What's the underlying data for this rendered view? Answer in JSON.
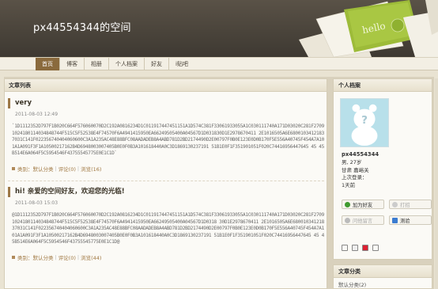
{
  "header": {
    "site_title": "px44554344的空间"
  },
  "nav": [
    {
      "label": "首页",
      "active": true
    },
    {
      "label": "博客",
      "active": false
    },
    {
      "label": "相册",
      "active": false
    },
    {
      "label": "个人档案",
      "active": false
    },
    {
      "label": "好友",
      "active": false
    },
    {
      "label": "i贴吧",
      "active": false
    }
  ],
  "main": {
    "heading": "文章列表",
    "posts": [
      {
        "title": "very",
        "date": "2011-08-03 12:49",
        "body": "`1D1112352D797F1B020C664F576060070D2C192A0816234D1C011917447451151A1D574C381F33061933055A1C030111740A171D03020C281F27091024180114034848744F515C5F52538E4F74570F6A4941415950EA66249505400A04567D1D031830D1E2978670411 2E1016505A6E68001034121837031C141F022356740404060600C3A1A235AC48E88BFC08AADADEB8A4ABD781D2BD2174490D2E00797F0B0E123E0D0B170F5E556A40745F454A7A101A1A091F3F1A10500217162B4D6948003007405B0E0F0B3A101618440A0C3D1869130237191 51B1E0F1F351901051F020C74416956447645 45 45B514E6A064F5C5954546F43755545775E0E1C1D`",
        "category": "类别：默认分类",
        "comments": "评论(0)",
        "views": "浏览(16)"
      },
      {
        "title": "hi! 亲爱的空间好友，欢迎您的光临!",
        "date": "2011-08-03 15:03",
        "body": "@1D1112352D797F1B020C664F576060070D2C192A0816234D1C011917447451151A1D574C381F33061933055A1C030111740A171D03020C281F27091024180114034848744F515C5F52538E4F74570F6A4941415950EA66249505400A04567D1D0318 30D1E2978670411 2E1016505A6E68001034121837031C141F022356740404060600C3A1A235AC48E88BFC08AADADEB8A4ABD781D2BD2174490D2E00797F0B0E123E0D0B170F5E556A40745F454A7A101A1A091F3F1A10500217162B4D6948003007405B0E0F0B3A101618440A0C3D1869130237191 51B1E0F1F351901051F020C74416956447645 45 45B514E6A064F5C5954546F43755545775E0E1C1D@",
        "category": "类别：默认分类",
        "comments": "评论(0)",
        "views": "浏览(44)"
      }
    ]
  },
  "sidebar": {
    "heading": "个人档案",
    "username": "px44554344",
    "lines": [
      "男, 27岁",
      "甘肃 嘉峪关",
      "上次登录：",
      "1天前"
    ],
    "actions": [
      {
        "label": "加为好友",
        "icon": "add-friend-icon",
        "enabled": true
      },
      {
        "label": "打招",
        "icon": "greet-icon",
        "enabled": false
      },
      {
        "label": "问他留言",
        "icon": "message-icon",
        "enabled": false
      },
      {
        "label": "测验",
        "icon": "quiz-icon",
        "enabled": true
      }
    ],
    "categories_heading": "文章分类",
    "categories": [
      "默认分类(2)"
    ]
  },
  "colors": {
    "accent": "#8a6a3d",
    "header_bg": "#4a443b",
    "page_bg": "#e9e3d2"
  }
}
